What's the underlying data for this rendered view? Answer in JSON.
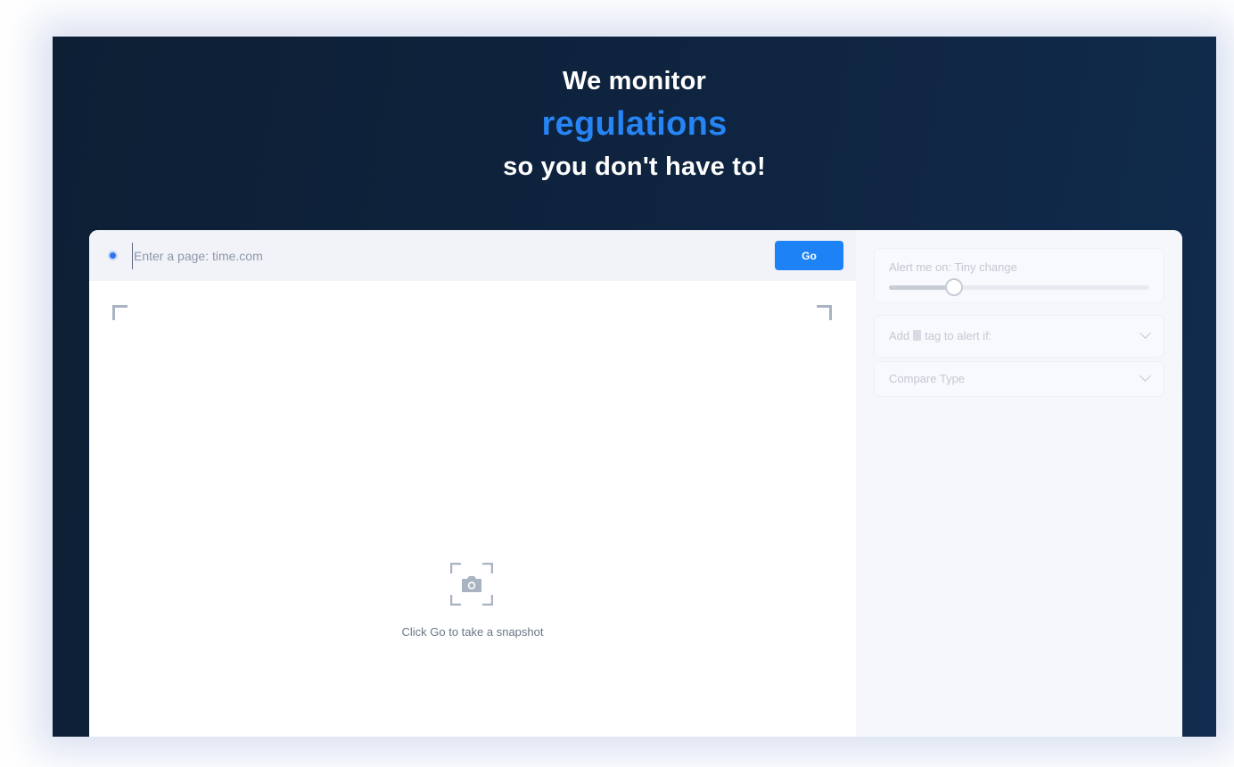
{
  "headline": {
    "line1": "We monitor",
    "line2": "regulations",
    "line3": "so you don't have to!"
  },
  "url_bar": {
    "placeholder": "Enter a page: time.com",
    "go_label": "Go"
  },
  "snapshot": {
    "hint": "Click Go to take a snapshot"
  },
  "settings": {
    "alert_label": "Alert me on: Tiny change",
    "alert_level": 0.25,
    "tag_label_before": "Add",
    "tag_label_after": "tag to alert if:",
    "compare_label": "Compare Type"
  },
  "colors": {
    "accent": "#1d82f5",
    "headline_highlight": "#2684f5",
    "hero_background": "#0f2440"
  },
  "icons": {
    "status": "status-dot-icon",
    "snapshot": "camera-icon",
    "tag": "tag-icon",
    "dropdown": "chevron-down-icon"
  }
}
